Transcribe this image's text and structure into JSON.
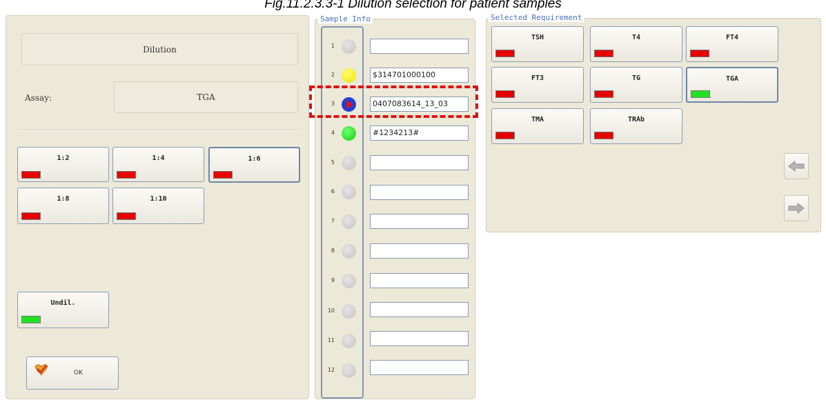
{
  "caption": "Fig.11.2.3.3-1 Dilution selection for patient samples",
  "left_panel": {
    "title": "Dilution",
    "assay_label": "Assay:",
    "assay_value": "TGA",
    "dilutions": [
      {
        "label": "1:2",
        "status": "red"
      },
      {
        "label": "1:4",
        "status": "red"
      },
      {
        "label": "1:6",
        "status": "red",
        "selected": true
      },
      {
        "label": "1:8",
        "status": "red"
      },
      {
        "label": "1:10",
        "status": "red"
      }
    ],
    "undil": {
      "label": "Undil.",
      "status": "green"
    },
    "ok_label": "OK"
  },
  "sample_info": {
    "legend": "Sample Info",
    "slots": [
      {
        "num": "1",
        "color": "gray",
        "id": ""
      },
      {
        "num": "2",
        "color": "yellow",
        "id": "$314701000100"
      },
      {
        "num": "3",
        "color": "blue-selected",
        "id": "0407083614_13_03"
      },
      {
        "num": "4",
        "color": "green",
        "id": "#1234213#"
      },
      {
        "num": "5",
        "color": "gray",
        "id": ""
      },
      {
        "num": "6",
        "color": "gray",
        "id": ""
      },
      {
        "num": "7",
        "color": "gray",
        "id": ""
      },
      {
        "num": "8",
        "color": "gray",
        "id": ""
      },
      {
        "num": "9",
        "color": "gray",
        "id": ""
      },
      {
        "num": "10",
        "color": "gray",
        "id": ""
      },
      {
        "num": "11",
        "color": "gray",
        "id": ""
      },
      {
        "num": "12",
        "color": "gray",
        "id": ""
      }
    ]
  },
  "requirements": {
    "legend": "Selected Requirement",
    "items": [
      {
        "label": "TSH",
        "status": "red"
      },
      {
        "label": "T4",
        "status": "red"
      },
      {
        "label": "FT4",
        "status": "red"
      },
      {
        "label": "FT3",
        "status": "red"
      },
      {
        "label": "TG",
        "status": "red"
      },
      {
        "label": "TGA",
        "status": "green",
        "selected": true
      },
      {
        "label": "TMA",
        "status": "red"
      },
      {
        "label": "TRAb",
        "status": "red"
      }
    ]
  },
  "nav": {
    "left_icon": "arrow-left-icon",
    "right_icon": "arrow-right-icon"
  },
  "colors": {
    "red": "#e60000",
    "green": "#22e022",
    "yellow": "#ffee00",
    "gray": "#cfcfcf",
    "blue": "#1f3fd8",
    "panel": "#ede9d9"
  }
}
